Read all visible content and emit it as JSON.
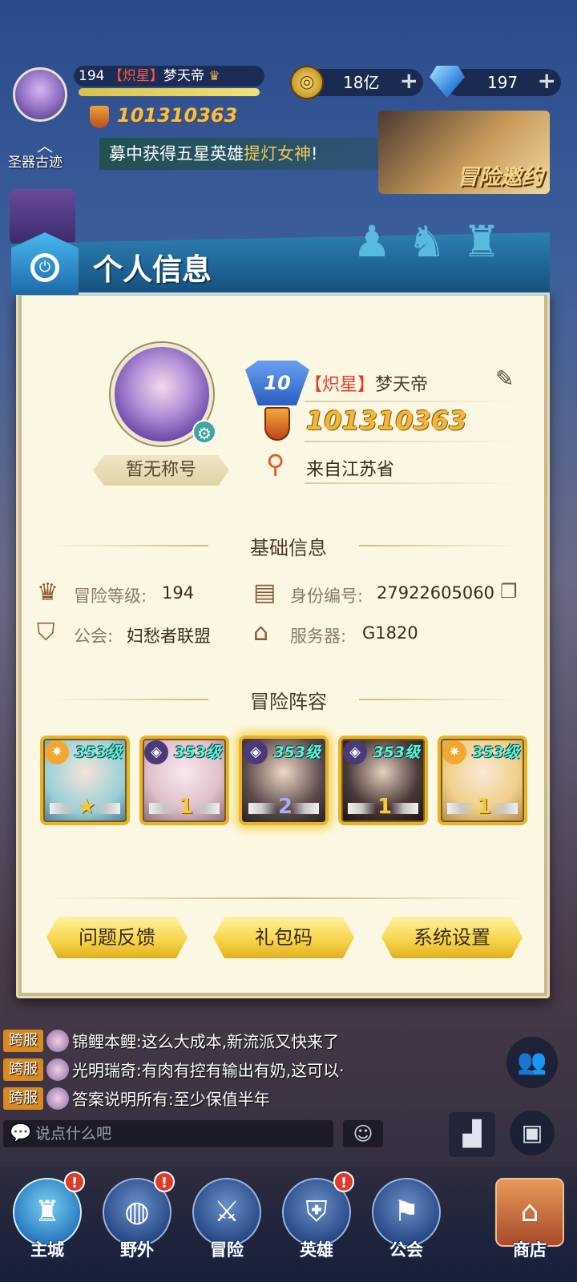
{
  "top": {
    "level": "194",
    "name_tag": "【炽星】",
    "name": "梦天帝",
    "uid": "101310363",
    "gold": "18亿",
    "gems": "197",
    "ruins_label": "圣器古迹",
    "marquee_prefix": "募中获得五星英雄",
    "marquee_highlight": "提灯女神",
    "marquee_suffix": "!",
    "adventure_invite": "冒险邀约"
  },
  "panel": {
    "title": "个人信息",
    "title_badge": "暂无称号",
    "badge_level": "10",
    "name_tag": "【炽星】",
    "name": "梦天帝",
    "uid": "101310363",
    "location": "来自江苏省",
    "basic_section": "基础信息",
    "info": {
      "adv_level_label": "冒险等级:",
      "adv_level_value": "194",
      "id_label": "身份编号:",
      "id_value": "27922605060",
      "guild_label": "公会:",
      "guild_value": "妇愁者联盟",
      "server_label": "服务器:",
      "server_value": "G1820"
    },
    "lineup_section": "冒险阵容",
    "heroes": [
      {
        "level": "353级",
        "stars": "★",
        "element": "light"
      },
      {
        "level": "353级",
        "stars": "1",
        "element": "dark"
      },
      {
        "level": "353级",
        "stars": "2",
        "element": "dark"
      },
      {
        "level": "353级",
        "stars": "1",
        "element": "dark"
      },
      {
        "level": "353级",
        "stars": "1",
        "element": "light"
      }
    ],
    "buttons": {
      "feedback": "问题反馈",
      "gift_code": "礼包码",
      "settings": "系统设置"
    }
  },
  "chat": {
    "messages": [
      {
        "tag": "跨服",
        "text": "锦鲤本鲤:这么大成本,新流派又快来了"
      },
      {
        "tag": "跨服",
        "text": "光明瑞奇:有肉有控有输出有奶,这可以·"
      },
      {
        "tag": "跨服",
        "text": "答案说明所有:至少保值半年"
      }
    ],
    "input_placeholder": "说点什么吧"
  },
  "nav": {
    "items": [
      {
        "label": "主城",
        "badge": "!"
      },
      {
        "label": "野外",
        "badge": "!"
      },
      {
        "label": "冒险",
        "badge": ""
      },
      {
        "label": "英雄",
        "badge": "!"
      },
      {
        "label": "公会",
        "badge": ""
      },
      {
        "label": "商店",
        "badge": ""
      }
    ]
  },
  "colors": {
    "panel_bg": "#fbf7e2",
    "header_blue": "#1e6496",
    "gold_text": "#f2b737",
    "button_yellow": "#f6d246",
    "tag_red": "#e0402a"
  },
  "icons": [
    "gold-coin-icon",
    "gem-icon",
    "plus-icon",
    "edit-icon",
    "shield-icon",
    "location-icon",
    "crown-icon",
    "id-card-icon",
    "guild-icon",
    "server-icon",
    "copy-icon",
    "gear-icon"
  ]
}
